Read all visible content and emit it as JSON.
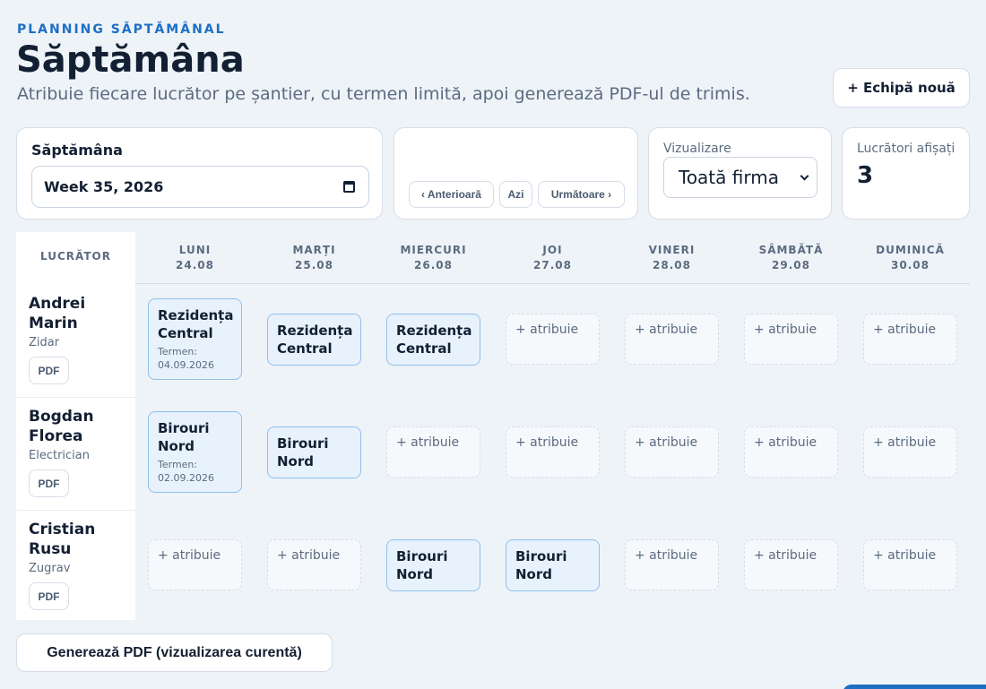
{
  "header": {
    "eyebrow": "PLANNING SĂPTĂMÂNAL",
    "title": "Săptămâna",
    "subtitle": "Atribuie fiecare lucrător pe șantier, cu termen limită, apoi generează PDF-ul de trimis.",
    "new_team_label": "+ Echipă nouă"
  },
  "week_card": {
    "label": "Săptămâna",
    "value": "Week 35, 2026"
  },
  "nav": {
    "prev": "‹ Anterioară",
    "today": "Azi",
    "next": "Următoare ›"
  },
  "view": {
    "label": "Vizualizare",
    "selected": "Toată firma"
  },
  "count": {
    "label": "Lucrători afișați",
    "value": "3"
  },
  "grid": {
    "worker_header": "LUCRĂTOR",
    "days": [
      {
        "name": "LUNI",
        "date": "24.08"
      },
      {
        "name": "MARȚI",
        "date": "25.08"
      },
      {
        "name": "MIERCURI",
        "date": "26.08"
      },
      {
        "name": "JOI",
        "date": "27.08"
      },
      {
        "name": "VINERI",
        "date": "28.08"
      },
      {
        "name": "SÂMBĂTĂ",
        "date": "29.08"
      },
      {
        "name": "DUMINICĂ",
        "date": "30.08"
      }
    ],
    "empty_label": "+ atribuie",
    "pdf_label": "PDF",
    "workers": [
      {
        "name": "Andrei Marin",
        "role": "Zidar",
        "cells": [
          {
            "site": "Rezidența Central",
            "deadline": "Termen: 04.09.2026"
          },
          {
            "site": "Rezidența Central"
          },
          {
            "site": "Rezidența Central"
          },
          null,
          null,
          null,
          null
        ]
      },
      {
        "name": "Bogdan Florea",
        "role": "Electrician",
        "cells": [
          {
            "site": "Birouri Nord",
            "deadline": "Termen: 02.09.2026"
          },
          {
            "site": "Birouri Nord"
          },
          null,
          null,
          null,
          null,
          null
        ]
      },
      {
        "name": "Cristian Rusu",
        "role": "Zugrav",
        "cells": [
          null,
          null,
          {
            "site": "Birouri Nord"
          },
          {
            "site": "Birouri Nord"
          },
          null,
          null,
          null
        ]
      }
    ]
  },
  "footer": {
    "generate_pdf_label": "Generează PDF (vizualizarea curentă)"
  }
}
